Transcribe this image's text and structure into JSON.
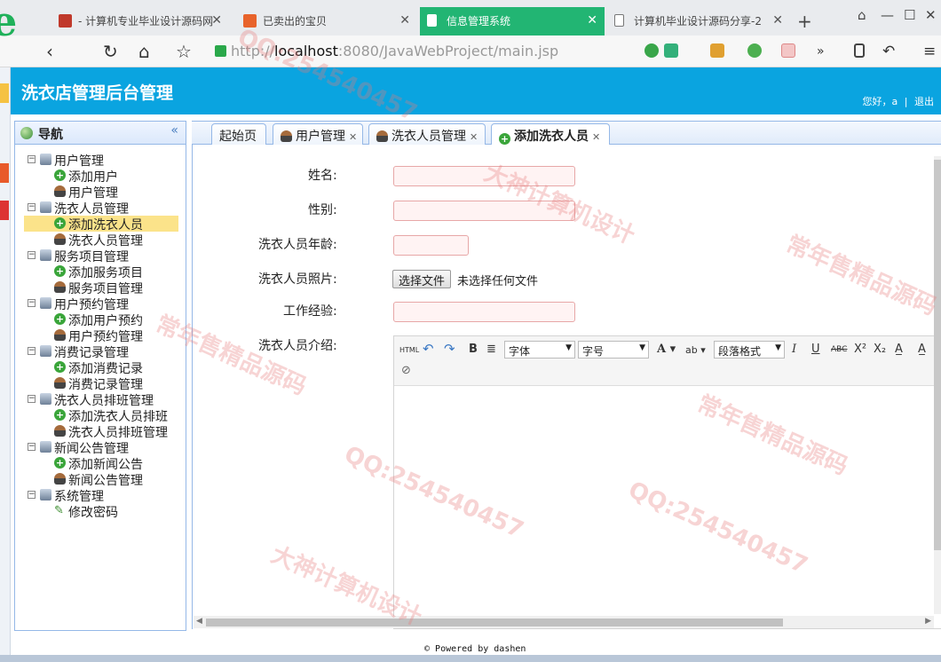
{
  "browser": {
    "tabs": [
      {
        "label": "- 计算机专业毕业设计源码网",
        "active": false
      },
      {
        "label": "已卖出的宝贝",
        "active": false
      },
      {
        "label": "信息管理系统",
        "active": true
      },
      {
        "label": "计算机毕业设计源码分享-2",
        "active": false
      }
    ],
    "url_protocol": "http://",
    "url_host": "localhost",
    "url_rest": ":8080/JavaWebProject/main.jsp"
  },
  "app": {
    "title": "洗衣店管理后台管理",
    "greeting": "您好，a",
    "logout": "退出"
  },
  "nav": {
    "title": "导航",
    "groups": [
      {
        "label": "用户管理",
        "items": [
          {
            "label": "添加用户",
            "icon": "plus-icon"
          },
          {
            "label": "用户管理",
            "icon": "user-icon"
          }
        ]
      },
      {
        "label": "洗衣人员管理",
        "items": [
          {
            "label": "添加洗衣人员",
            "icon": "plus-icon",
            "selected": true
          },
          {
            "label": "洗衣人员管理",
            "icon": "user-icon"
          }
        ]
      },
      {
        "label": "服务项目管理",
        "items": [
          {
            "label": "添加服务项目",
            "icon": "plus-icon"
          },
          {
            "label": "服务项目管理",
            "icon": "user-icon"
          }
        ]
      },
      {
        "label": "用户预约管理",
        "items": [
          {
            "label": "添加用户预约",
            "icon": "plus-icon"
          },
          {
            "label": "用户预约管理",
            "icon": "user-icon"
          }
        ]
      },
      {
        "label": "消费记录管理",
        "items": [
          {
            "label": "添加消费记录",
            "icon": "plus-icon"
          },
          {
            "label": "消费记录管理",
            "icon": "user-icon"
          }
        ]
      },
      {
        "label": "洗衣人员排班管理",
        "items": [
          {
            "label": "添加洗衣人员排班",
            "icon": "plus-icon"
          },
          {
            "label": "洗衣人员排班管理",
            "icon": "user-icon"
          }
        ]
      },
      {
        "label": "新闻公告管理",
        "items": [
          {
            "label": "添加新闻公告",
            "icon": "plus-icon"
          },
          {
            "label": "新闻公告管理",
            "icon": "user-icon"
          }
        ]
      },
      {
        "label": "系统管理",
        "items": [
          {
            "label": "修改密码",
            "icon": "pencil-icon"
          }
        ]
      }
    ]
  },
  "content_tabs": [
    {
      "label": "起始页",
      "closable": false
    },
    {
      "label": "用户管理",
      "closable": true
    },
    {
      "label": "洗衣人员管理",
      "closable": true
    },
    {
      "label": "添加洗衣人员",
      "closable": true,
      "active": true
    }
  ],
  "form": {
    "name_label": "姓名:",
    "sex_label": "性别:",
    "age_label": "洗衣人员年龄:",
    "photo_label": "洗衣人员照片:",
    "file_button": "选择文件",
    "file_status": "未选择任何文件",
    "experience_label": "工作经验:",
    "intro_label": "洗衣人员介绍:"
  },
  "editor": {
    "font_select": "字体",
    "size_select": "字号",
    "paragraph_select": "段落格式"
  },
  "footer": "Powered by dashen",
  "watermarks": [
    "QQ:254540457",
    "大神计算机设计",
    "常年售精品源码"
  ]
}
